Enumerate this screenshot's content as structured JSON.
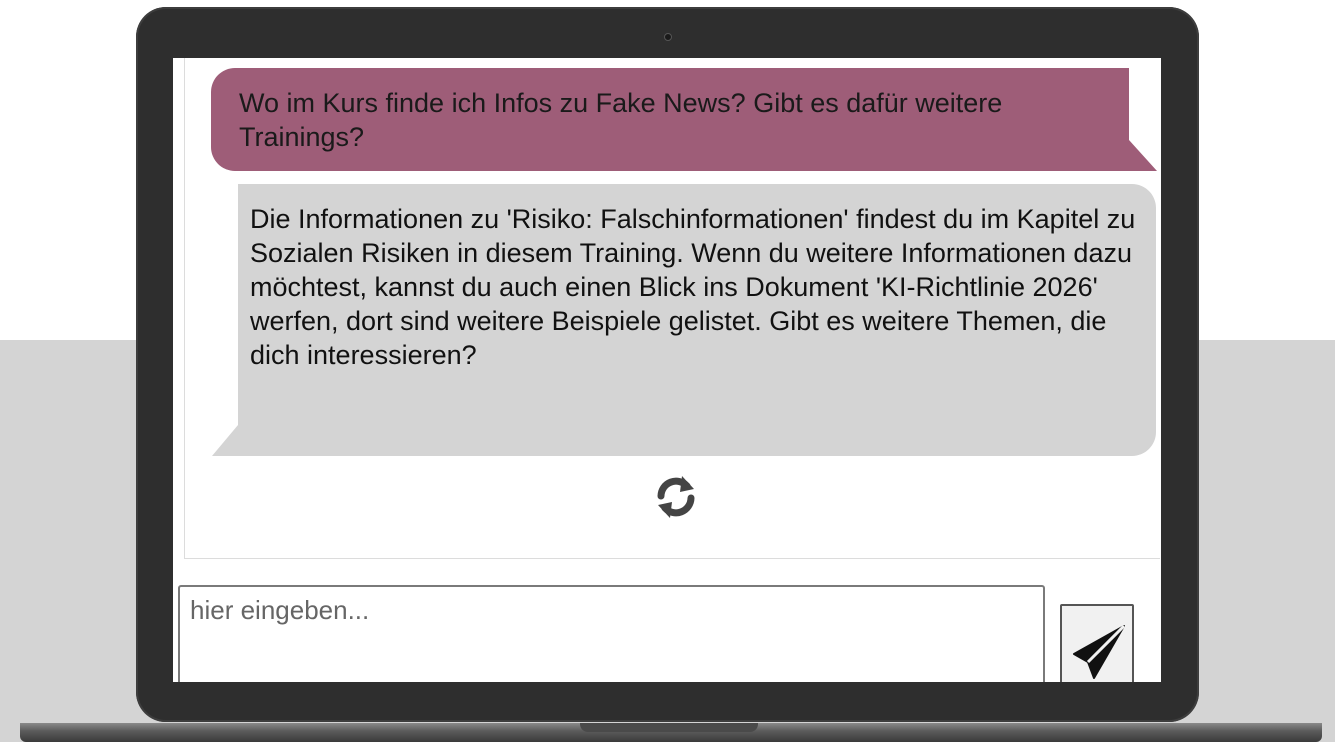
{
  "chat": {
    "user_message": "Wo im Kurs finde ich Infos zu Fake News? Gibt es dafür weitere Trainings?",
    "bot_message": "Die Informationen zu 'Risiko: Falschinformationen' findest du im Kapitel zu Sozialen Risiken in diesem Training. Wenn du weitere Informationen dazu möchtest, kannst du auch einen Blick ins Dokument 'KI-Richtlinie 2026' werfen, dort sind weitere Beispiele gelistet. Gibt es weitere Themen, die dich interessieren?"
  },
  "input": {
    "placeholder": "hier eingeben...",
    "value": ""
  },
  "icons": {
    "refresh": "refresh-icon",
    "send": "send-icon"
  },
  "colors": {
    "user_bubble": "#9e5d78",
    "bot_bubble": "#d4d4d4",
    "laptop_frame": "#2e2e2e",
    "background_band": "#d4d4d4"
  }
}
